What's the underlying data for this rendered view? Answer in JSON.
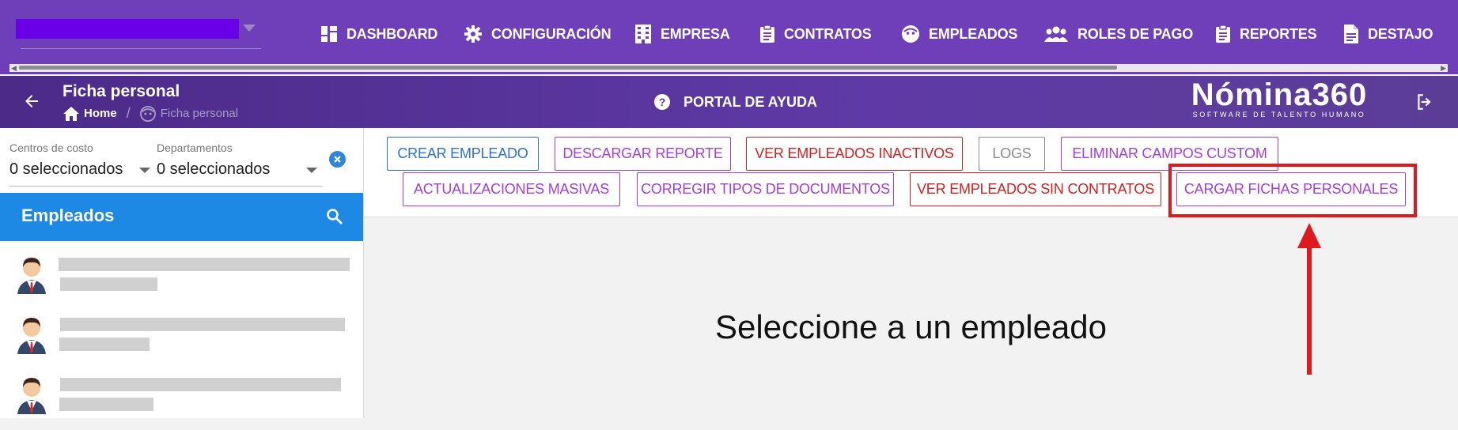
{
  "nav": {
    "items": [
      {
        "label": "DASHBOARD",
        "icon": "dashboard-icon"
      },
      {
        "label": "CONFIGURACIÓN",
        "icon": "gear-icon"
      },
      {
        "label": "EMPRESA",
        "icon": "building-icon"
      },
      {
        "label": "CONTRATOS",
        "icon": "clipboard-icon"
      },
      {
        "label": "EMPLEADOS",
        "icon": "face-icon"
      },
      {
        "label": "ROLES DE PAGO",
        "icon": "group-icon"
      },
      {
        "label": "REPORTES",
        "icon": "clipboard-icon"
      },
      {
        "label": "DESTAJO",
        "icon": "document-icon"
      }
    ]
  },
  "header": {
    "title": "Ficha personal",
    "breadcrumb": {
      "home": "Home",
      "current": "Ficha personal"
    },
    "help_label": "PORTAL DE AYUDA",
    "logo_main": "Nómina360",
    "logo_sub": "SOFTWARE DE TALENTO HUMANO"
  },
  "filters": {
    "cost_center_label": "Centros de costo",
    "cost_center_value": "0 seleccionados",
    "department_label": "Departamentos",
    "department_value": "0 seleccionados"
  },
  "employees": {
    "title": "Empleados"
  },
  "actions": {
    "row1": [
      {
        "label": "CREAR EMPLEADO",
        "color": "#2f6fd6"
      },
      {
        "label": "DESCARGAR REPORTE",
        "color": "#a33ddb"
      },
      {
        "label": "VER EMPLEADOS INACTIVOS",
        "color": "#d32020"
      },
      {
        "label": "LOGS",
        "color": "#8a8a8a"
      },
      {
        "label": "ELIMINAR CAMPOS CUSTOM",
        "color": "#a33ddb"
      }
    ],
    "row2": [
      {
        "label": "ACTUALIZACIONES MASIVAS",
        "color": "#a33ddb"
      },
      {
        "label": "CORREGIR TIPOS DE DOCUMENTOS",
        "color": "#a33ddb"
      },
      {
        "label": "VER EMPLEADOS SIN CONTRATOS",
        "color": "#d32020"
      },
      {
        "label": "CARGAR FICHAS PERSONALES",
        "color": "#a33ddb"
      }
    ]
  },
  "main": {
    "placeholder": "Seleccione a un empleado"
  },
  "colors": {
    "topbar": "#6f3fba",
    "accent_blue": "#1e88e5",
    "annotation_red": "#e0191e"
  }
}
